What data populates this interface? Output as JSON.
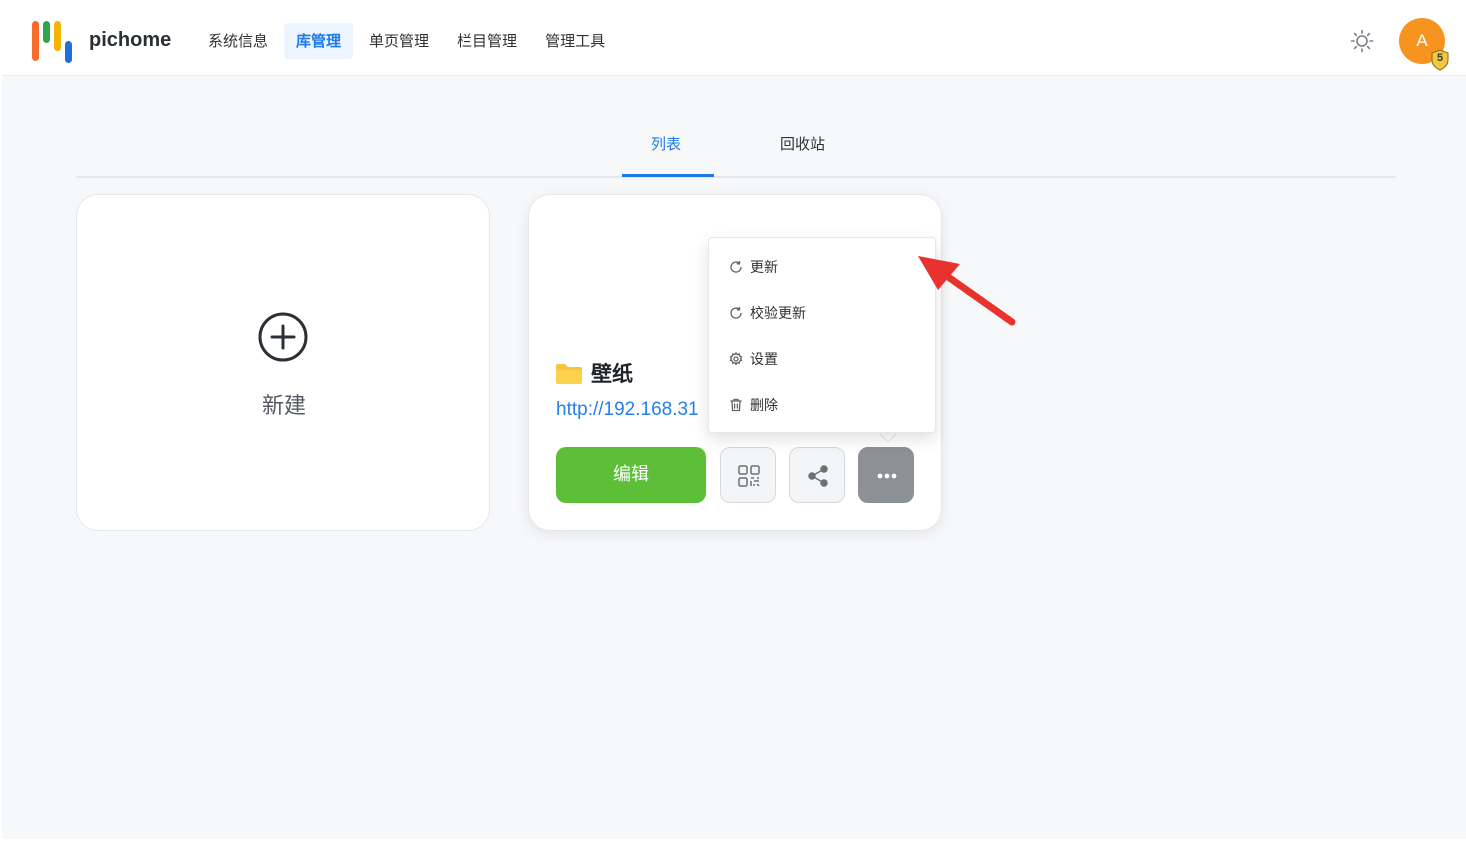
{
  "header": {
    "brand": "pichome",
    "nav": [
      "系统信息",
      "库管理",
      "单页管理",
      "栏目管理",
      "管理工具"
    ],
    "active_nav": "库管理",
    "theme_icon": "sun-icon",
    "avatar": {
      "initial": "A",
      "badge": "5"
    }
  },
  "tabs": {
    "items": [
      "列表",
      "回收站"
    ],
    "active": "列表"
  },
  "cards": {
    "new_label": "新建",
    "library": {
      "name": "壁纸",
      "url": "http://192.168.31",
      "edit_label": "编辑",
      "buttons": [
        "qrcode-icon",
        "share-icon",
        "more-icon"
      ]
    }
  },
  "dropdown": {
    "items": [
      {
        "label": "更新",
        "icon": "refresh-icon"
      },
      {
        "label": "校验更新",
        "icon": "refresh-icon"
      },
      {
        "label": "设置",
        "icon": "gear-icon"
      },
      {
        "label": "删除",
        "icon": "trash-icon"
      }
    ]
  },
  "colors": {
    "primary": "#1e7ae8",
    "edit_green": "#5cbf37",
    "avatar_orange": "#f79420",
    "annotation_red": "#e8322e",
    "folder_yellow": "#f8c53a"
  }
}
